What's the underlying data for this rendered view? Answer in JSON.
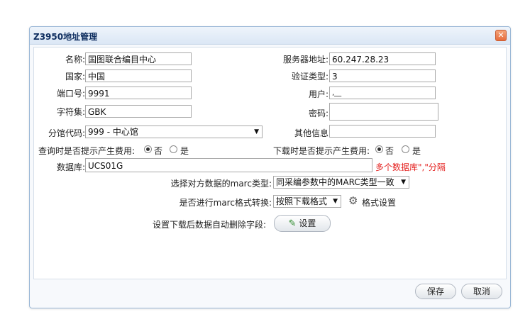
{
  "dialog": {
    "title": "Z3950地址管理",
    "close_glyph": "✕"
  },
  "form": {
    "name_label": "名称:",
    "name_value": "国图联合编目中心",
    "server_label": "服务器地址:",
    "server_value": "60.247.28.23",
    "country_label": "国家:",
    "country_value": "中国",
    "auth_label": "验证类型:",
    "auth_value": "3",
    "port_label": "端口号:",
    "port_value": "9991",
    "user_label": "用户:",
    "user_value": ",__",
    "charset_label": "字符集:",
    "charset_value": "GBK",
    "password_label": "密码:",
    "password_value": "",
    "branch_label": "分馆代码:",
    "branch_value": "999 - 中心馆",
    "other_label": "其他信息",
    "other_value": "",
    "query_fee_label": "查询时是否提示产生费用:",
    "download_fee_label": "下载时是否提示产生费用:",
    "no_label": "否",
    "yes_label": "是",
    "db_label": "数据库:",
    "db_value": "UCS01G",
    "db_note": "多个数据库\",\"分隔",
    "marc_type_label": "选择对方数据的marc类型:",
    "marc_type_value": "同采编参数中的MARC类型一致",
    "convert_label": "是否进行marc格式转换:",
    "convert_value": "按照下载格式",
    "format_settings_label": "格式设置",
    "delete_fields_label": "设置下载后数据自动删除字段:",
    "settings_button": "设置"
  },
  "footer": {
    "save": "保存",
    "cancel": "取消"
  },
  "icons": {
    "dropdown": "▼",
    "gear": "⚙",
    "pencil": "✎"
  }
}
